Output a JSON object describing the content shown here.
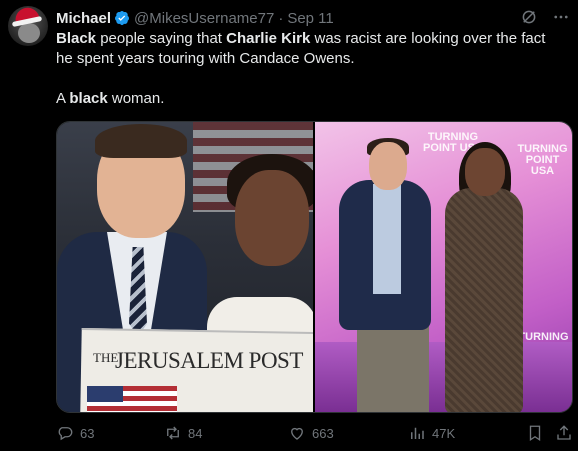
{
  "author": {
    "name": "Michael",
    "handle": "@MikesUsername77",
    "separator": "·",
    "date": "Sep 11",
    "avatar_icon": "santa-hat-dog-avatar",
    "verified_color": "#1d9bf0"
  },
  "tweet": {
    "line1_part1_bold": "Black",
    "line1_part2": " people saying that ",
    "line1_part3_bold": "Charlie Kirk",
    "line1_part4": " was racist are looking over the fact he spent years touring with Candace Owens.",
    "line2_part1": "A ",
    "line2_part2_bold": "black",
    "line2_part3": " woman."
  },
  "media": {
    "left_photo": {
      "newspaper_the": "THE",
      "newspaper_title": "JERUSALEM POST"
    },
    "right_photo": {
      "logo_lines": [
        "TURNING",
        "POINT USA"
      ]
    }
  },
  "actions": {
    "replies": "63",
    "reposts": "84",
    "likes": "663",
    "views": "47K"
  },
  "colors": {
    "background": "#000000",
    "text": "#e7e9ea",
    "secondary": "#71767b",
    "accent": "#1d9bf0"
  }
}
